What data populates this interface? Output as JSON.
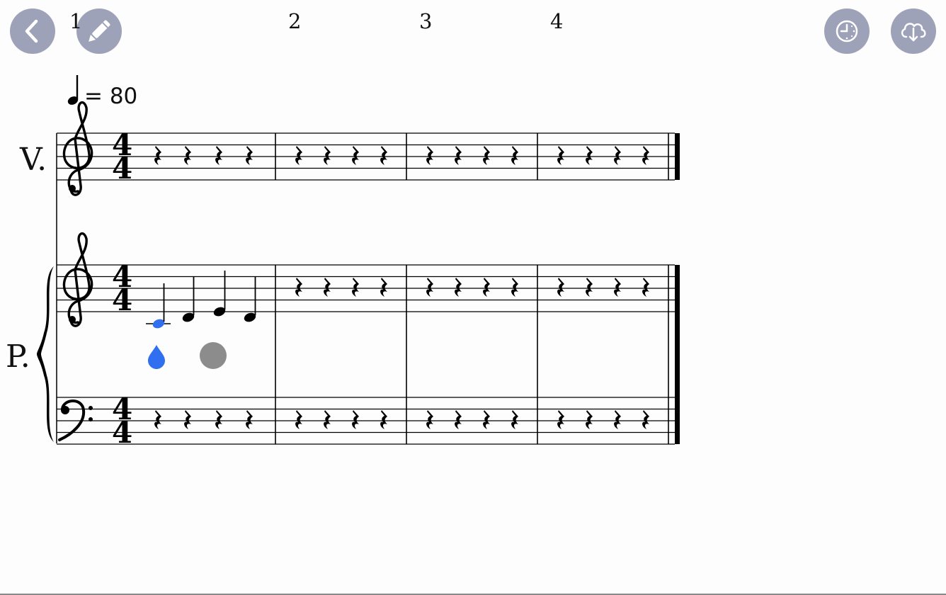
{
  "toolbar": {
    "back_icon": "chevron-left-icon",
    "edit_icon": "pencil-icon",
    "history_icon": "clock-icon",
    "download_icon": "cloud-download-icon"
  },
  "score": {
    "measure_numbers": [
      "1",
      "2",
      "3",
      "4"
    ],
    "tempo": "= 80",
    "time_signature": {
      "numerator": "4",
      "denominator": "4"
    },
    "instruments": [
      {
        "abbr": "V.",
        "staves": [
          "treble"
        ]
      },
      {
        "abbr": "P.",
        "staves": [
          "treble",
          "bass"
        ]
      }
    ],
    "piano_measure1_notes": [
      "C4",
      "D4",
      "E4",
      "D4"
    ],
    "colors": {
      "button_bg": "#9ea2b8",
      "selected_note": "#2f6ff0",
      "cursor_handle": "#2f6ff0",
      "drag_knob": "#8c8c8c"
    }
  }
}
